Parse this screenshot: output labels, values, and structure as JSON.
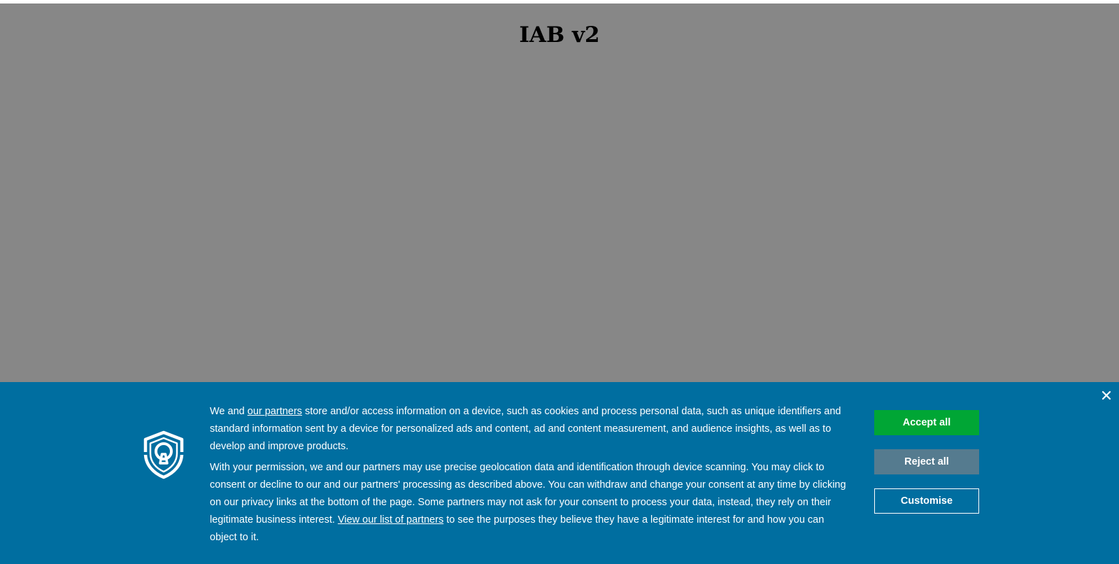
{
  "page": {
    "title": "IAB v2"
  },
  "consent_banner": {
    "paragraph1": {
      "prefix": "We and ",
      "link": "our partners",
      "suffix": " store and/or access information on a device, such as cookies and process personal data, such as unique identifiers and standard information sent by a device for personalized ads and content, ad and content measurement, and audience insights, as well as to develop and improve products."
    },
    "paragraph2": {
      "prefix": "With your permission, we and our partners may use precise geolocation data and identification through device scanning. You may click to consent or decline to our and our partners' processing as described above. You can withdraw and change your consent at any time by clicking on our privacy links at the bottom of the page. Some partners may not ask for your consent to process your data, instead, they rely on their legitimate business interest. ",
      "link": "View our list of partners",
      "suffix": " to see the purposes they believe they have a legitimate interest for and how you can object to it."
    },
    "buttons": {
      "accept": "Accept all",
      "reject": "Reject all",
      "customise": "Customise"
    },
    "icons": {
      "close": "close-icon",
      "shield": "shield-keyhole-icon"
    },
    "colors": {
      "banner_background": "#006ea0",
      "accept": "#00a635",
      "reject": "#557b8f",
      "overlay": "#878787"
    }
  }
}
